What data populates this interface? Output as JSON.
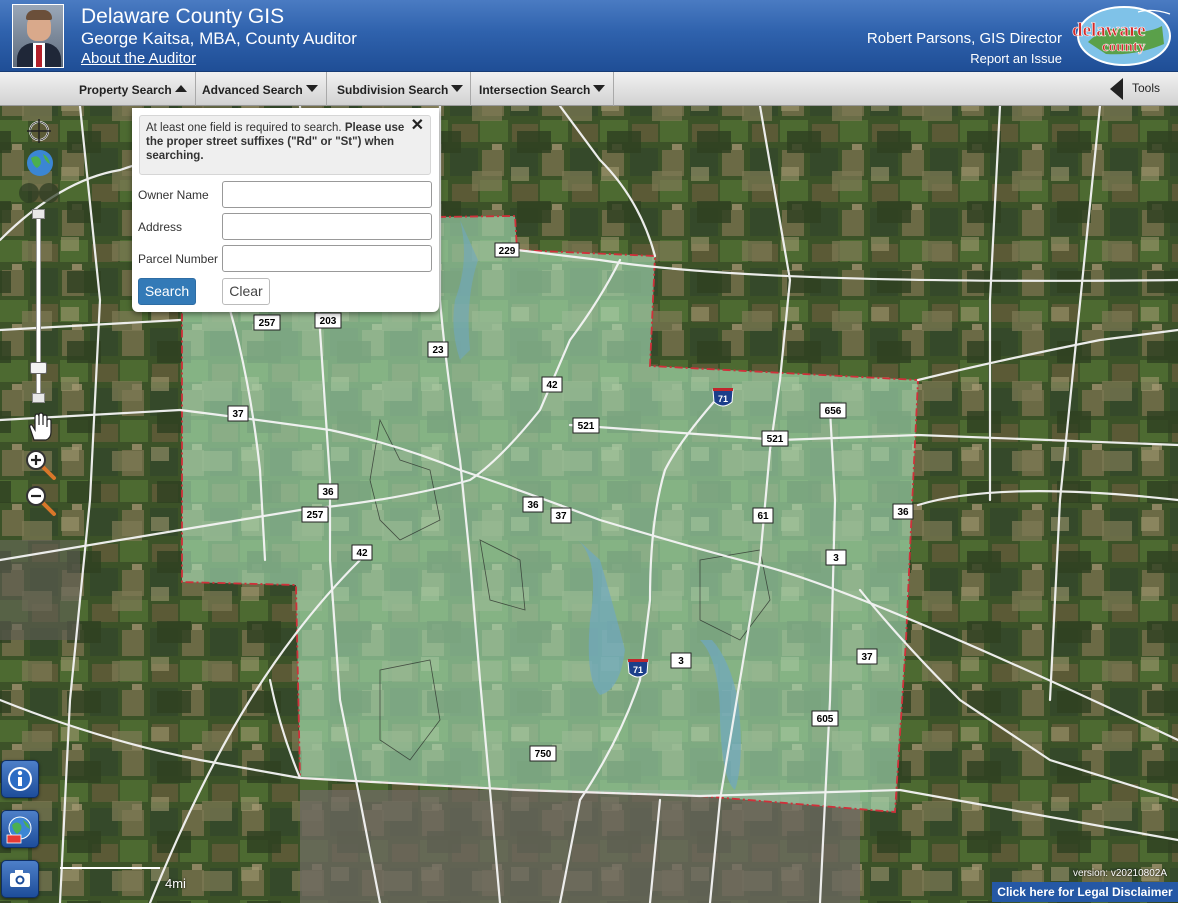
{
  "header": {
    "title": "Delaware County GIS",
    "subtitle": "George Kaitsa, MBA, County Auditor",
    "about_link": "About the Auditor",
    "director": "Robert Parsons, GIS Director",
    "report_link": "Report an Issue",
    "logo_text_top": "delaware",
    "logo_text_bottom": "county"
  },
  "nav": {
    "items": [
      {
        "label": "Property Search",
        "expanded": true
      },
      {
        "label": "Advanced Search",
        "expanded": false
      },
      {
        "label": "Subdivision Search",
        "expanded": false
      },
      {
        "label": "Intersection Search",
        "expanded": false
      }
    ],
    "tools_label": "Tools"
  },
  "search_panel": {
    "notice_plain": "At least one field is required to search. ",
    "notice_bold": "Please use the proper street suffixes (\"Rd\" or \"St\") when searching.",
    "close_glyph": "✕",
    "fields": [
      {
        "label": "Owner Name",
        "value": "",
        "placeholder": ""
      },
      {
        "label": "Address",
        "value": "",
        "placeholder": ""
      },
      {
        "label": "Parcel Number",
        "value": "",
        "placeholder": ""
      }
    ],
    "search_label": "Search",
    "clear_label": "Clear"
  },
  "map": {
    "basemap": "satellite imagery",
    "overlay_color": "#a8e0b8",
    "boundary_color": "#d0303a",
    "route_shields": [
      "229",
      "257",
      "203",
      "23",
      "42",
      "71",
      "656",
      "521",
      "521",
      "37",
      "36",
      "257",
      "36",
      "37",
      "61",
      "36",
      "42",
      "3",
      "37",
      "3",
      "71",
      "605",
      "750"
    ],
    "scale_label": "4mi",
    "version": "version: v20210802A"
  },
  "controls": {
    "icons": [
      "crosshair-icon",
      "globe-icon",
      "pan-hand-icon",
      "zoom-in-icon",
      "zoom-out-icon",
      "info-icon",
      "basemap-globe-icon",
      "camera-icon"
    ]
  },
  "footer": {
    "disclaimer": "Click here for Legal Disclaimer"
  }
}
